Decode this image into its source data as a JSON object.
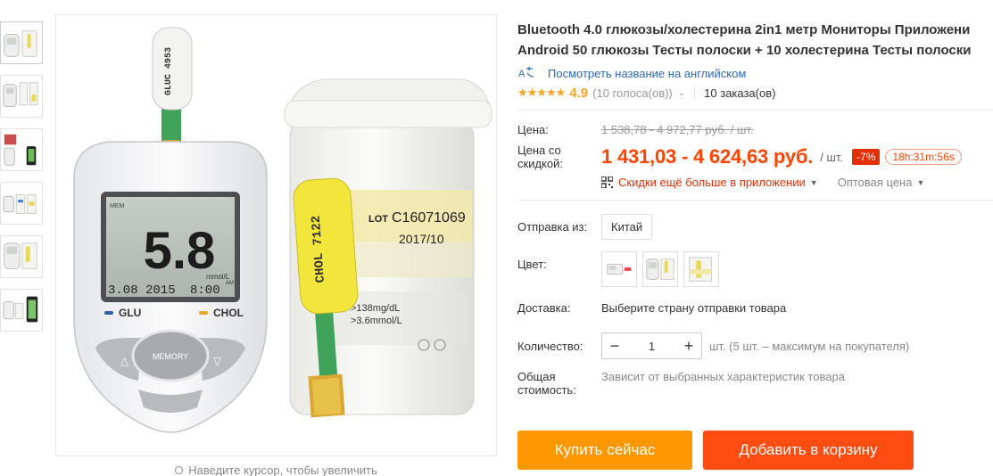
{
  "product": {
    "title_line1": "Bluetooth 4.0 глюкозы/холестерина 2in1 метр Мониторы Приложени",
    "title_line2": "Android 50 глюкозы Тесты полоски + 10 холестерина Тесты полоски",
    "translate_link": "Посмотреть название на английском",
    "translate_icon": "translate-icon",
    "rating": {
      "stars": "★★★★★",
      "value": "4.9",
      "votes": "(10 голоса(ов))",
      "orders": "10 заказа(ов)"
    }
  },
  "price": {
    "label": "Цена:",
    "old": "1 538,78 - 4 972,77 руб. / шт.",
    "discount_label": "Цена со скидкой:",
    "new": "1 431,03 - 4 624,63 руб.",
    "unit": "/ шт.",
    "discount": "-7%",
    "timer": "18h:31m:56s",
    "app_promo": "Скидки ещё больше в приложении",
    "wholesale": "Оптовая цена"
  },
  "options": {
    "ship_from_label": "Отправка из:",
    "ship_from_value": "Китай",
    "color_label": "Цвет:",
    "delivery_label": "Доставка:",
    "delivery_value": "Выберите страну отправки товара",
    "quantity_label": "Количество:",
    "quantity_value": "1",
    "quantity_note": "шт. (5 шт. – максимум на покупателя)",
    "total_label": "Общая стоимость:",
    "total_value": "Зависит от выбранных характеристик товара"
  },
  "actions": {
    "buy": "Купить сейчас",
    "cart": "Добавить в корзину"
  },
  "gallery": {
    "zoom_hint": "Наведите курсор, чтобы увеличить",
    "meter": {
      "strip_code": "GLUC 4953",
      "mem": "MEM",
      "reading": "5.8",
      "unit": "mmol/L",
      "date": "3.08 2015",
      "time": "8:00",
      "am": "AM",
      "glu": "GLU",
      "chol": "CHOL",
      "memory_btn": "MEMORY"
    },
    "bottle": {
      "lot_label": "LOT",
      "lot_no": "C16071069",
      "exp": "2017/10",
      "range1": ">138mg/dL",
      "range2": ">3.6mmol/L",
      "strip_code": "CHOL 7122"
    }
  },
  "colors": {
    "accent": "#ff4400",
    "buy": "#ff9800",
    "cart": "#ff4d12",
    "link": "#2d6ab6",
    "star": "#f5a623"
  }
}
